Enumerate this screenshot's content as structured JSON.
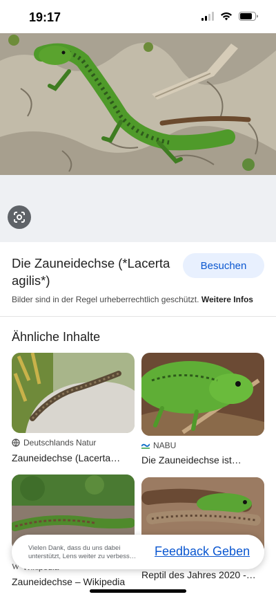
{
  "status_bar": {
    "time": "19:17"
  },
  "result": {
    "title": "Die Zauneidechse (*Lacerta agilis*)",
    "visit_label": "Besuchen",
    "copyright_text": "Bilder sind in der Regel urheberrechtlich geschützt.",
    "more_info_label": "Weitere Infos"
  },
  "similar": {
    "heading": "Ähnliche Inhalte",
    "items": [
      {
        "source": "Deutschlands Natur",
        "title": "Zauneidechse (Lacerta…",
        "source_icon": "globe-icon"
      },
      {
        "source": "NABU",
        "title": "Die Zauneidechse ist…",
        "source_icon": "nabu-logo"
      },
      {
        "source": "Wikipedia",
        "title": "Zauneidechse – Wikipedia",
        "source_icon": "wikipedia-icon"
      },
      {
        "source": "",
        "title": "Reptil des Jahres 2020 -…",
        "source_icon": ""
      }
    ]
  },
  "feedback": {
    "text": "Vielen Dank, dass du uns dabei unterstützt, Lens weiter zu verbess…",
    "link_label": "Feedback Geben"
  },
  "colors": {
    "accent": "#0b57d0",
    "pill_bg": "#e8f0fe",
    "lens_button": "#5f6368"
  }
}
